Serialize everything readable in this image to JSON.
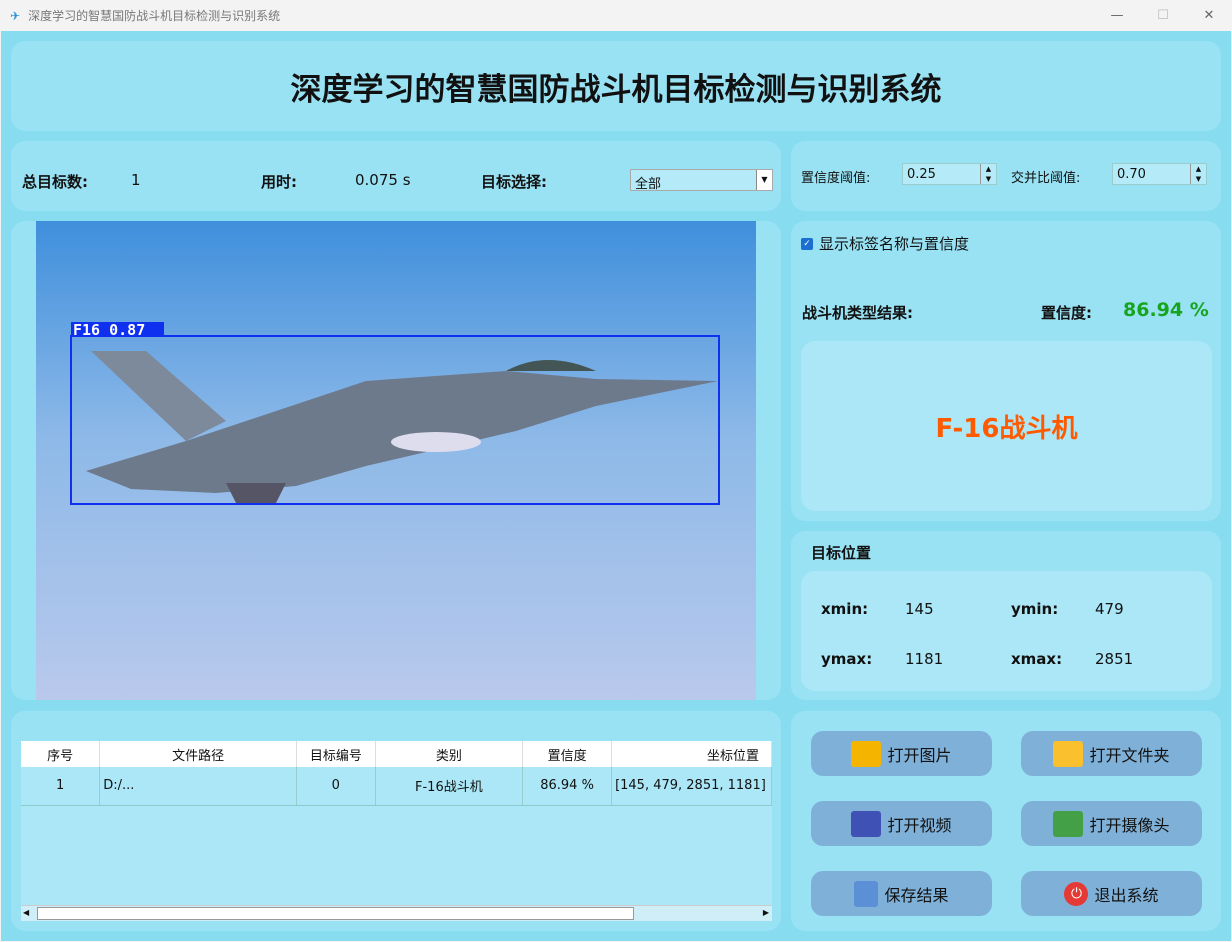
{
  "window": {
    "title": "深度学习的智慧国防战斗机目标检测与识别系统",
    "minimize": "—",
    "maximize": "☐",
    "close": "✕"
  },
  "header": {
    "title": "深度学习的智慧国防战斗机目标检测与识别系统"
  },
  "stats": {
    "total_label": "总目标数:",
    "total_value": "1",
    "time_label": "用时:",
    "time_value": "0.075 s",
    "select_label": "目标选择:",
    "select_value": "全部"
  },
  "params": {
    "conf_label": "置信度阈值:",
    "conf_value": "0.25",
    "iou_label": "交并比阈值:",
    "iou_value": "0.70"
  },
  "detection": {
    "label": "F16 0.87"
  },
  "options": {
    "show_label": "显示标签名称与置信度",
    "show_checked": true
  },
  "result": {
    "type_label": "战斗机类型结果:",
    "conf_label": "置信度:",
    "conf_value": "86.94 %",
    "class_name": "F-16战斗机",
    "class_color": "#ff5a00",
    "conf_color": "#17a51d"
  },
  "position": {
    "title": "目标位置",
    "xmin_label": "xmin:",
    "xmin": "145",
    "ymin_label": "ymin:",
    "ymin": "479",
    "ymax_label": "ymax:",
    "ymax": "1181",
    "xmax_label": "xmax:",
    "xmax": "2851"
  },
  "table": {
    "headers": [
      "序号",
      "文件路径",
      "目标编号",
      "类别",
      "置信度",
      "坐标位置"
    ],
    "rows": [
      [
        "1",
        "D:/...",
        "0",
        "F-16战斗机",
        "86.94 %",
        "[145, 479, 2851, 1181]"
      ]
    ]
  },
  "buttons": {
    "open_image": "打开图片",
    "open_folder": "打开文件夹",
    "open_video": "打开视频",
    "open_camera": "打开摄像头",
    "save": "保存结果",
    "exit": "退出系统"
  }
}
